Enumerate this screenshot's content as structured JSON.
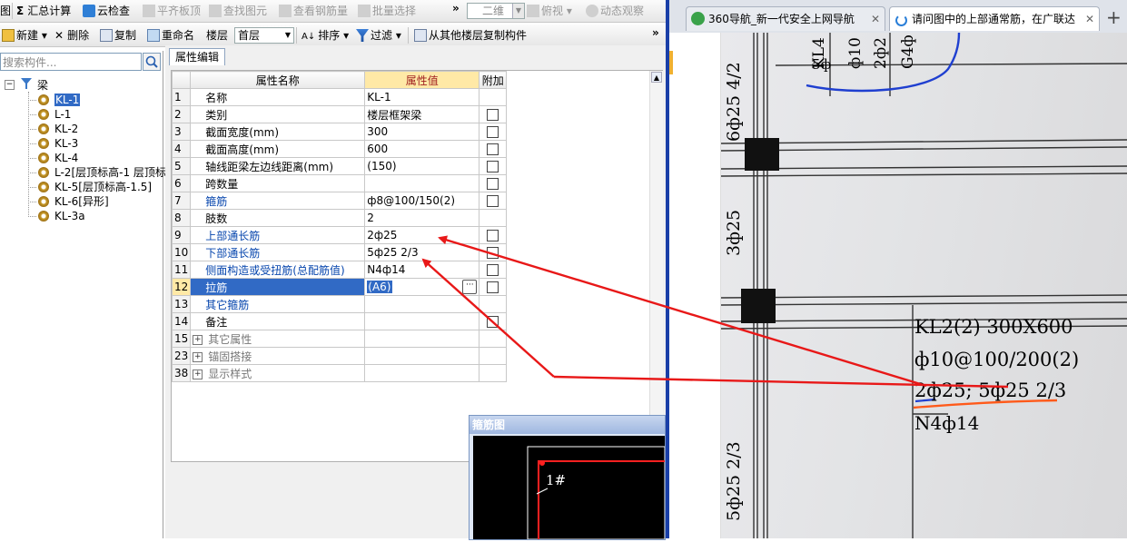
{
  "toolbar1": {
    "left_fragment": "图",
    "sum_label": "汇总计算",
    "cloud_check": "云检查",
    "flat_top": "平齐板顶",
    "find_element": "查找图元",
    "view_rebar": "查看钢筋量",
    "batch_select": "批量选择",
    "overflow": "»",
    "view_mode": "二维",
    "top_view": "俯视",
    "dynamic_view": "动态观察"
  },
  "toolbar2": {
    "new": "新建",
    "delete": "删除",
    "copy": "复制",
    "rename": "重命名",
    "floor_label": "楼层",
    "floor_value": "首层",
    "sort": "排序",
    "filter": "过滤",
    "copy_from_floor": "从其他楼层复制构件",
    "overflow": "»"
  },
  "left_panel": {
    "search_placeholder": "搜索构件...",
    "root": "梁",
    "items": [
      "KL-1",
      "L-1",
      "KL-2",
      "KL-3",
      "KL-4",
      "L-2[层顶标高-1 层顶标",
      "KL-5[层顶标高-1.5]",
      "KL-6[异形]",
      "KL-3a"
    ]
  },
  "props": {
    "tab": "属性编辑",
    "col_name": "属性名称",
    "col_value": "属性值",
    "col_extra": "附加",
    "rows": [
      {
        "num": "1",
        "name": "名称",
        "value": "KL-1",
        "check": false
      },
      {
        "num": "2",
        "name": "类别",
        "value": "楼层框架梁",
        "check": true
      },
      {
        "num": "3",
        "name": "截面宽度(mm)",
        "value": "300",
        "check": true
      },
      {
        "num": "4",
        "name": "截面高度(mm)",
        "value": "600",
        "check": true
      },
      {
        "num": "5",
        "name": "轴线距梁左边线距离(mm)",
        "value": "(150)",
        "check": true
      },
      {
        "num": "6",
        "name": "跨数量",
        "value": "",
        "check": true
      },
      {
        "num": "7",
        "name": "箍筋",
        "value": "ф8@100/150(2)",
        "check": true
      },
      {
        "num": "8",
        "name": "肢数",
        "value": "2",
        "check": false
      },
      {
        "num": "9",
        "name": "上部通长筋",
        "value": "2ф25",
        "check": true
      },
      {
        "num": "10",
        "name": "下部通长筋",
        "value": "5ф25 2/3",
        "check": true
      },
      {
        "num": "11",
        "name": "侧面构造或受扭筋(总配筋值)",
        "value": "N4ф14",
        "check": true
      },
      {
        "num": "12",
        "name": "拉筋",
        "value": "(A6)",
        "check": true
      },
      {
        "num": "13",
        "name": "其它箍筋",
        "value": "",
        "check": false
      },
      {
        "num": "14",
        "name": "备注",
        "value": "",
        "check": true
      },
      {
        "num": "15",
        "name": "其它属性",
        "value": "",
        "check": false
      },
      {
        "num": "23",
        "name": "锚固搭接",
        "value": "",
        "check": false
      },
      {
        "num": "38",
        "name": "显示样式",
        "value": "",
        "check": false
      }
    ]
  },
  "stirrup_window": {
    "title": "箍筋图",
    "label": "1#"
  },
  "browser": {
    "tab1": "360导航_新一代安全上网导航",
    "tab2": "请问图中的上部通常筋，在广联达",
    "new_tab": "+"
  },
  "photo_text": {
    "kl": "KL2(2) 300X600",
    "stirrup": "ф10@100/200(2)",
    "rebar": "2ф25; 5ф25 2/3",
    "side": "N4ф14",
    "left1": "6ф25 4/2",
    "left2": "3ф25",
    "left3": "5ф25 2/3",
    "top1": "KL4",
    "top2": "ф10",
    "top3": "2ф2",
    "top4": "G4ф",
    "top5": "5ф"
  },
  "colors": {
    "annotation_red": "#e81818",
    "selection_blue": "#316ac5",
    "header_value_bg": "#ffe9a6",
    "divider": "#1a3fa8"
  }
}
